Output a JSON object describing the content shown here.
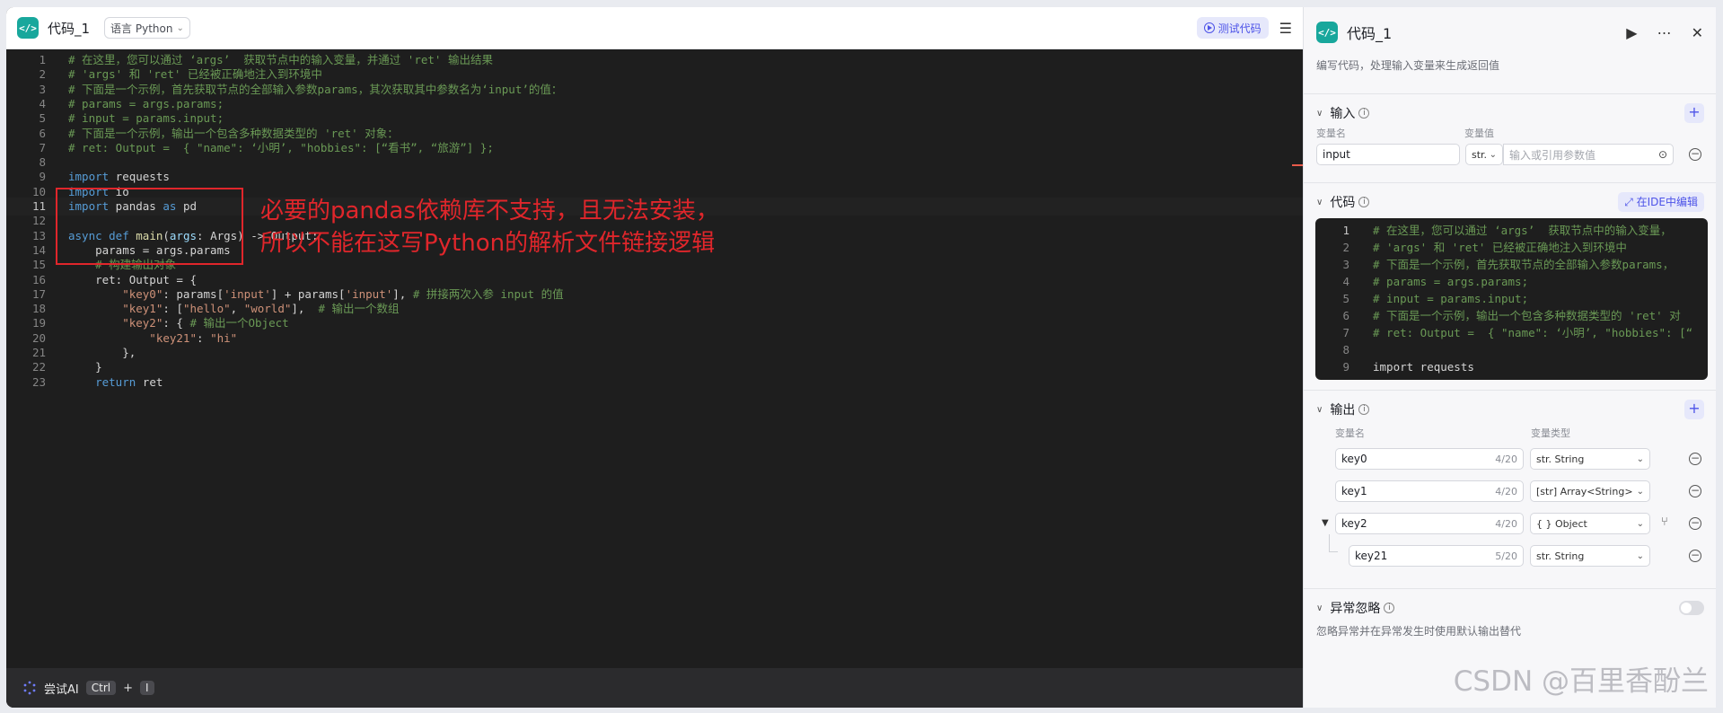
{
  "editor": {
    "title": "代码_1",
    "language_chip": "语言 Python",
    "test_button": "测试代码",
    "code_lines": [
      {
        "n": "1",
        "parts": [
          {
            "c": "c-comment",
            "t": "# 在这里，您可以通过 ‘args’  获取节点中的输入变量，并通过 'ret' 输出结果"
          }
        ]
      },
      {
        "n": "2",
        "parts": [
          {
            "c": "c-comment",
            "t": "# 'args' 和 'ret' 已经被正确地注入到环境中"
          }
        ]
      },
      {
        "n": "3",
        "parts": [
          {
            "c": "c-comment",
            "t": "# 下面是一个示例，首先获取节点的全部输入参数params，其次获取其中参数名为‘input’的值："
          }
        ]
      },
      {
        "n": "4",
        "parts": [
          {
            "c": "c-comment",
            "t": "# params = args.params;"
          }
        ]
      },
      {
        "n": "5",
        "parts": [
          {
            "c": "c-comment",
            "t": "# input = params.input;"
          }
        ]
      },
      {
        "n": "6",
        "parts": [
          {
            "c": "c-comment",
            "t": "# 下面是一个示例，输出一个包含多种数据类型的 'ret' 对象："
          }
        ]
      },
      {
        "n": "7",
        "parts": [
          {
            "c": "c-comment",
            "t": "# ret: Output =  { \"name\": ‘小明’, \"hobbies\": [“看书”, “旅游”] };"
          }
        ]
      },
      {
        "n": "8",
        "parts": []
      },
      {
        "n": "9",
        "parts": [
          {
            "c": "c-kw",
            "t": "import"
          },
          {
            "c": "c-plain",
            "t": " requests"
          }
        ]
      },
      {
        "n": "10",
        "parts": [
          {
            "c": "c-kw",
            "t": "import"
          },
          {
            "c": "c-plain",
            "t": " io"
          }
        ]
      },
      {
        "n": "11",
        "parts": [
          {
            "c": "c-kw",
            "t": "import"
          },
          {
            "c": "c-plain",
            "t": " pandas "
          },
          {
            "c": "c-kw",
            "t": "as"
          },
          {
            "c": "c-plain",
            "t": " pd"
          }
        ]
      },
      {
        "n": "12",
        "parts": []
      },
      {
        "n": "13",
        "parts": [
          {
            "c": "c-kw",
            "t": "async def "
          },
          {
            "c": "c-fn",
            "t": "main"
          },
          {
            "c": "c-plain",
            "t": "("
          },
          {
            "c": "c-var",
            "t": "args"
          },
          {
            "c": "c-plain",
            "t": ": Args) -> Output:"
          }
        ]
      },
      {
        "n": "14",
        "parts": [
          {
            "c": "c-plain",
            "t": "    params = args.params"
          }
        ]
      },
      {
        "n": "15",
        "parts": [
          {
            "c": "c-comment",
            "t": "    # 构建输出对象"
          }
        ]
      },
      {
        "n": "16",
        "parts": [
          {
            "c": "c-plain",
            "t": "    ret: Output = {"
          }
        ]
      },
      {
        "n": "17",
        "parts": [
          {
            "c": "c-str",
            "t": "        \"key0\""
          },
          {
            "c": "c-plain",
            "t": ": params["
          },
          {
            "c": "c-str",
            "t": "'input'"
          },
          {
            "c": "c-plain",
            "t": "] + params["
          },
          {
            "c": "c-str",
            "t": "'input'"
          },
          {
            "c": "c-plain",
            "t": "], "
          },
          {
            "c": "c-comment",
            "t": "# 拼接两次入参 input 的值"
          }
        ]
      },
      {
        "n": "18",
        "parts": [
          {
            "c": "c-str",
            "t": "        \"key1\""
          },
          {
            "c": "c-plain",
            "t": ": ["
          },
          {
            "c": "c-str",
            "t": "\"hello\""
          },
          {
            "c": "c-plain",
            "t": ", "
          },
          {
            "c": "c-str",
            "t": "\"world\""
          },
          {
            "c": "c-plain",
            "t": "],  "
          },
          {
            "c": "c-comment",
            "t": "# 输出一个数组"
          }
        ]
      },
      {
        "n": "19",
        "parts": [
          {
            "c": "c-str",
            "t": "        \"key2\""
          },
          {
            "c": "c-plain",
            "t": ": { "
          },
          {
            "c": "c-comment",
            "t": "# 输出一个Object"
          }
        ]
      },
      {
        "n": "20",
        "parts": [
          {
            "c": "c-str",
            "t": "            \"key21\""
          },
          {
            "c": "c-plain",
            "t": ": "
          },
          {
            "c": "c-str",
            "t": "\"hi\""
          }
        ]
      },
      {
        "n": "21",
        "parts": [
          {
            "c": "c-plain",
            "t": "        },"
          }
        ]
      },
      {
        "n": "22",
        "parts": [
          {
            "c": "c-plain",
            "t": "    }"
          }
        ]
      },
      {
        "n": "23",
        "parts": [
          {
            "c": "c-kw",
            "t": "    return"
          },
          {
            "c": "c-plain",
            "t": " ret"
          }
        ]
      }
    ],
    "annotation_line1": "必要的pandas依赖库不支持，且无法安装，",
    "annotation_line2": "所以不能在这写Python的解析文件链接逻辑",
    "ai_label": "尝试AI",
    "ai_key1": "Ctrl",
    "ai_plus": "+",
    "ai_key2": "I"
  },
  "sidebar": {
    "title": "代码_1",
    "description": "编写代码，处理输入变量来生成返回值",
    "input_section": {
      "label": "输入",
      "col_name": "变量名",
      "col_value": "变量值",
      "name_value": "input",
      "type_short": "str.",
      "value_placeholder": "输入或引用参数值"
    },
    "code_section": {
      "label": "代码",
      "ide_button": "在IDE中编辑",
      "lines": [
        {
          "n": "1",
          "c": "c-comment",
          "t": "# 在这里，您可以通过 ‘args’  获取节点中的输入变量，"
        },
        {
          "n": "2",
          "c": "c-comment",
          "t": "# 'args' 和 'ret' 已经被正确地注入到环境中"
        },
        {
          "n": "3",
          "c": "c-comment",
          "t": "# 下面是一个示例，首先获取节点的全部输入参数params，"
        },
        {
          "n": "4",
          "c": "c-comment",
          "t": "# params = args.params;"
        },
        {
          "n": "5",
          "c": "c-comment",
          "t": "# input = params.input;"
        },
        {
          "n": "6",
          "c": "c-comment",
          "t": "# 下面是一个示例，输出一个包含多种数据类型的 'ret' 对"
        },
        {
          "n": "7",
          "c": "c-comment",
          "t": "# ret: Output =  { \"name\": ‘小明’, \"hobbies\": [“"
        },
        {
          "n": "8",
          "c": "c-plain",
          "t": ""
        },
        {
          "n": "9",
          "c": "c-plain",
          "t": "import requests"
        }
      ]
    },
    "output_section": {
      "label": "输出",
      "col_name": "变量名",
      "col_type": "变量类型",
      "rows": [
        {
          "name": "key0",
          "count": "4/20",
          "type": "str. String"
        },
        {
          "name": "key1",
          "count": "4/20",
          "type": "[str] Array<String>"
        },
        {
          "name": "key2",
          "count": "4/20",
          "type": "{ } Object"
        },
        {
          "name": "key21",
          "count": "5/20",
          "type": "str. String"
        }
      ]
    },
    "exception_section": {
      "label": "异常忽略",
      "description": "忽略异常并在异常发生时使用默认输出替代"
    }
  },
  "watermark": "CSDN @百里香酚兰",
  "colors": {
    "accent": "#4d53e8",
    "node_icon": "#18a79c",
    "annotation": "#e0262b"
  }
}
